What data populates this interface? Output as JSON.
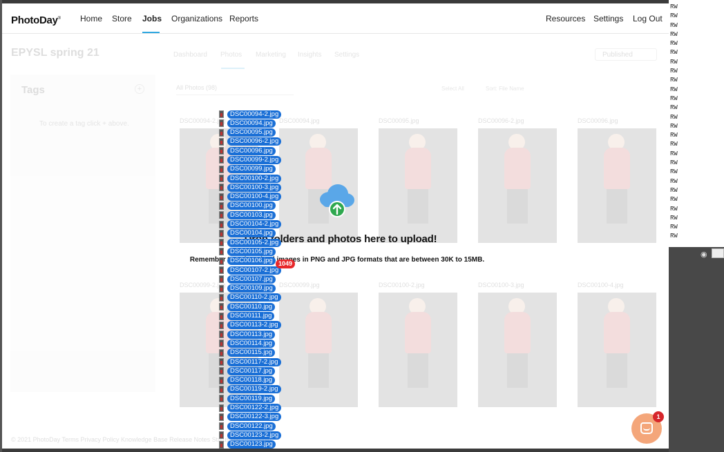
{
  "background": {
    "rw_lines": [
      "RW",
      "RW",
      "RW",
      "RW",
      "RW",
      "RW",
      "RW",
      "RW",
      "RW",
      "RW",
      "RW",
      "RW",
      "RW",
      "RW",
      "RW",
      "RW",
      "RW",
      "RW",
      "RW",
      "RW",
      "RW",
      "RW",
      "RW",
      "RW",
      "RW",
      "RW"
    ]
  },
  "navbar": {
    "logo": "PhotoDay",
    "logo_mark": "®",
    "items": [
      "Home",
      "Store",
      "Jobs",
      "Organizations",
      "Reports"
    ],
    "active": "Jobs",
    "right_items": [
      "Resources",
      "Settings",
      "Log Out"
    ],
    "accent_color": "#2ea7e0"
  },
  "page": {
    "job_title": "EPYSL spring 21",
    "subtabs": [
      "Dashboard",
      "Photos",
      "Marketing",
      "Insights",
      "Settings"
    ],
    "active_subtab": "Photos",
    "status": "Published",
    "tags_title": "Tags",
    "tags_hint": "To create a tag click + above.",
    "filter_label": "All Photos (98)",
    "select_all": "Select All",
    "sort_label": "Sort: File Name",
    "photos": [
      "DSC00094-2.jpg",
      "DSC00094.jpg",
      "DSC00095.jpg",
      "DSC00096-2.jpg",
      "DSC00096.jpg",
      "DSC00099-2.jpg",
      "DSC00099.jpg",
      "DSC00100-2.jpg",
      "DSC00100-3.jpg",
      "DSC00100-4.jpg"
    ],
    "footer": "© 2021 PhotoDay   Terms   Privacy Policy   Knowledge Base   Release Notes   Status   Back to Studio"
  },
  "drop_overlay": {
    "heading": "Drop folders and photos here to upload!",
    "subtext": "Remember to only upload images in PNG and JPG formats that are between 30K to 15MB.",
    "drag_count": "1049",
    "drag_color": "#1a6fd6",
    "dragged_files": [
      "DSC00094-2.jpg",
      "DSC00094.jpg",
      "DSC00095.jpg",
      "DSC00096-2.jpg",
      "DSC00096.jpg",
      "DSC00099-2.jpg",
      "DSC00099.jpg",
      "DSC00100-2.jpg",
      "DSC00100-3.jpg",
      "DSC00100-4.jpg",
      "DSC00100.jpg",
      "DSC00103.jpg",
      "DSC00104-2.jpg",
      "DSC00104.jpg",
      "DSC00105-2.jpg",
      "DSC00105.jpg",
      "DSC00106.jpg",
      "DSC00107-2.jpg",
      "DSC00107.jpg",
      "DSC00109.jpg",
      "DSC00110-2.jpg",
      "DSC00110.jpg",
      "DSC00111.jpg",
      "DSC00113-2.jpg",
      "DSC00113.jpg",
      "DSC00114.jpg",
      "DSC00115.jpg",
      "DSC00117-2.jpg",
      "DSC00117.jpg",
      "DSC00118.jpg",
      "DSC00119-2.jpg",
      "DSC00119.jpg",
      "DSC00122-2.jpg",
      "DSC00122-3.jpg",
      "DSC00122.jpg",
      "DSC00123-2.jpg",
      "DSC00123.jpg"
    ]
  },
  "chat": {
    "badge_count": "1",
    "color": "#f4a67a"
  }
}
